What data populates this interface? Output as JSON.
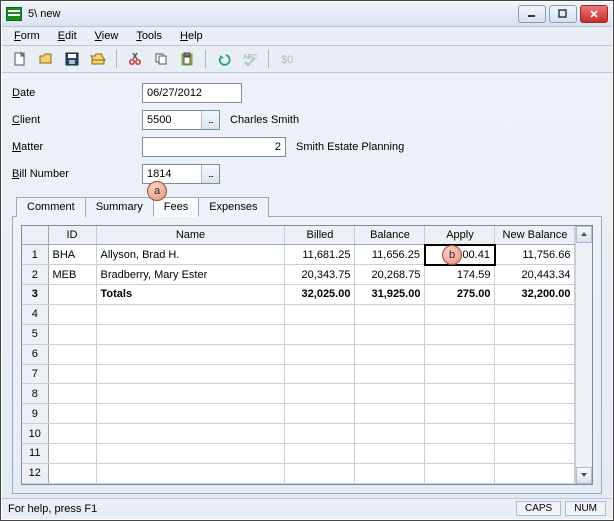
{
  "window": {
    "title": "5\\ new"
  },
  "menu": [
    "Form",
    "Edit",
    "View",
    "Tools",
    "Help"
  ],
  "callouts": {
    "a": "a",
    "b": "b"
  },
  "form": {
    "date": {
      "label": "Date",
      "value": "06/27/2012"
    },
    "client": {
      "label": "Client",
      "code": "5500",
      "name": "Charles Smith"
    },
    "matter": {
      "label": "Matter",
      "num": "2",
      "desc": "Smith Estate Planning"
    },
    "bill": {
      "label": "Bill Number",
      "value": "1814"
    }
  },
  "tabs": [
    "Comment",
    "Summary",
    "Fees",
    "Expenses"
  ],
  "tab_active_index": 2,
  "grid": {
    "headers": [
      "",
      "ID",
      "Name",
      "Billed",
      "Balance",
      "Apply",
      "New Balance"
    ],
    "rows": [
      {
        "id": "BHA",
        "name": "Allyson, Brad H.",
        "billed": "11,681.25",
        "balance": "11,656.25",
        "apply": "100.41",
        "newbal": "11,756.66"
      },
      {
        "id": "MEB",
        "name": "Bradberry, Mary Ester",
        "billed": "20,343.75",
        "balance": "20,268.75",
        "apply": "174.59",
        "newbal": "20,443.34"
      }
    ],
    "totals": {
      "name": "Totals",
      "billed": "32,025.00",
      "balance": "31,925.00",
      "apply": "275.00",
      "newbal": "32,200.00"
    },
    "blank_rows": 9
  },
  "status": {
    "help": "For help, press F1",
    "caps": "CAPS",
    "num": "NUM"
  }
}
